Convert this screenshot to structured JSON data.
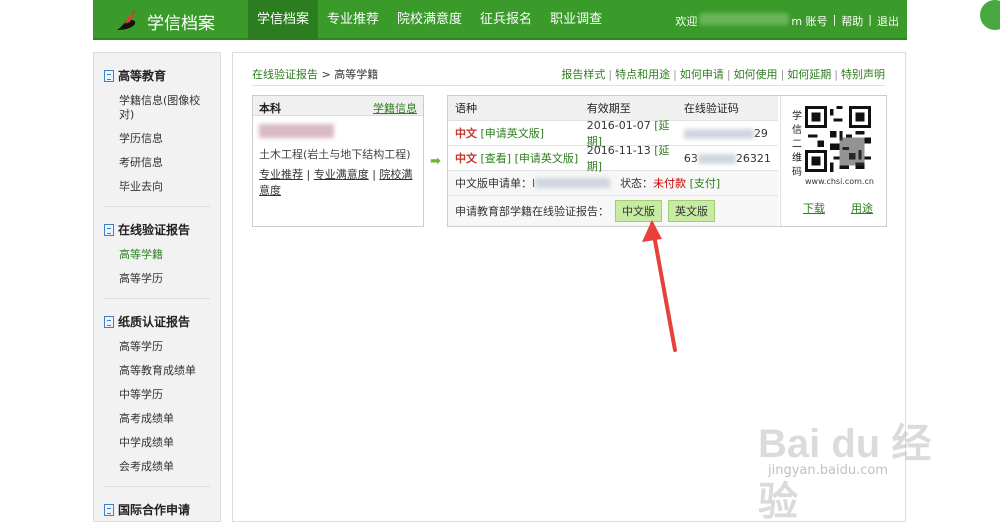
{
  "header": {
    "app_title": "学信档案",
    "nav": [
      "学信档案",
      "专业推荐",
      "院校满意度",
      "征兵报名",
      "职业调查"
    ],
    "welcome": "欢迎",
    "account_suffix": "m 账号",
    "help": "帮助",
    "logout": "退出",
    "sep": "|"
  },
  "sidebar": {
    "sections": [
      {
        "title": "高等教育",
        "items": [
          "学籍信息(图像校对)",
          "学历信息",
          "考研信息",
          "毕业去向"
        ]
      },
      {
        "title": "在线验证报告",
        "items": [
          "高等学籍",
          "高等学历"
        ]
      },
      {
        "title": "纸质认证报告",
        "items": [
          "高等学历",
          "高等教育成绩单",
          "中等学历",
          "高考成绩单",
          "中学成绩单",
          "会考成绩单"
        ]
      },
      {
        "title": "国际合作申请",
        "items": []
      }
    ]
  },
  "breadcrumb": {
    "link": "在线验证报告",
    "sep": " > ",
    "current": "高等学籍"
  },
  "toplinks": [
    "报告样式",
    "特点和用途",
    "如何申请",
    "如何使用",
    "如何延期",
    "特别声明"
  ],
  "left_panel": {
    "level": "本科",
    "link": "学籍信息",
    "major": "土木工程(岩土与地下结构工程)",
    "links": [
      "专业推荐",
      "专业满意度",
      "院校满意度"
    ]
  },
  "report_table": {
    "headers": [
      "语种",
      "有效期至",
      "在线验证码"
    ],
    "rows": [
      {
        "lang": "中文",
        "actions": [
          "[申请英文版]"
        ],
        "expiry": "2016-01-07",
        "extend": "[延期]",
        "code_tail": "29"
      },
      {
        "lang": "中文",
        "actions": [
          "[查看]",
          "[申请英文版]"
        ],
        "expiry": "2016-11-13",
        "extend": "[延期]",
        "code_head": "63",
        "code_tail": "26321"
      }
    ],
    "apply_label": "中文版申请单：l",
    "status_label": "状态：",
    "status_value": "未付款",
    "pay_link": "[支付]",
    "report_label": "申请教育部学籍在线验证报告：",
    "btn_cn": "中文版",
    "btn_en": "英文版"
  },
  "qr_panel": {
    "label": "学信二维码",
    "url": "www.chsi.com.cn",
    "download": "下载",
    "usage": "用途"
  },
  "watermark": {
    "brand": "Bai du 经验",
    "url": "jingyan.baidu.com"
  },
  "colors": {
    "brand_green": "#3a9a2a",
    "link_green": "#2e7d1f",
    "alert_red": "#c0392b",
    "arrow_red": "#e8413a"
  }
}
